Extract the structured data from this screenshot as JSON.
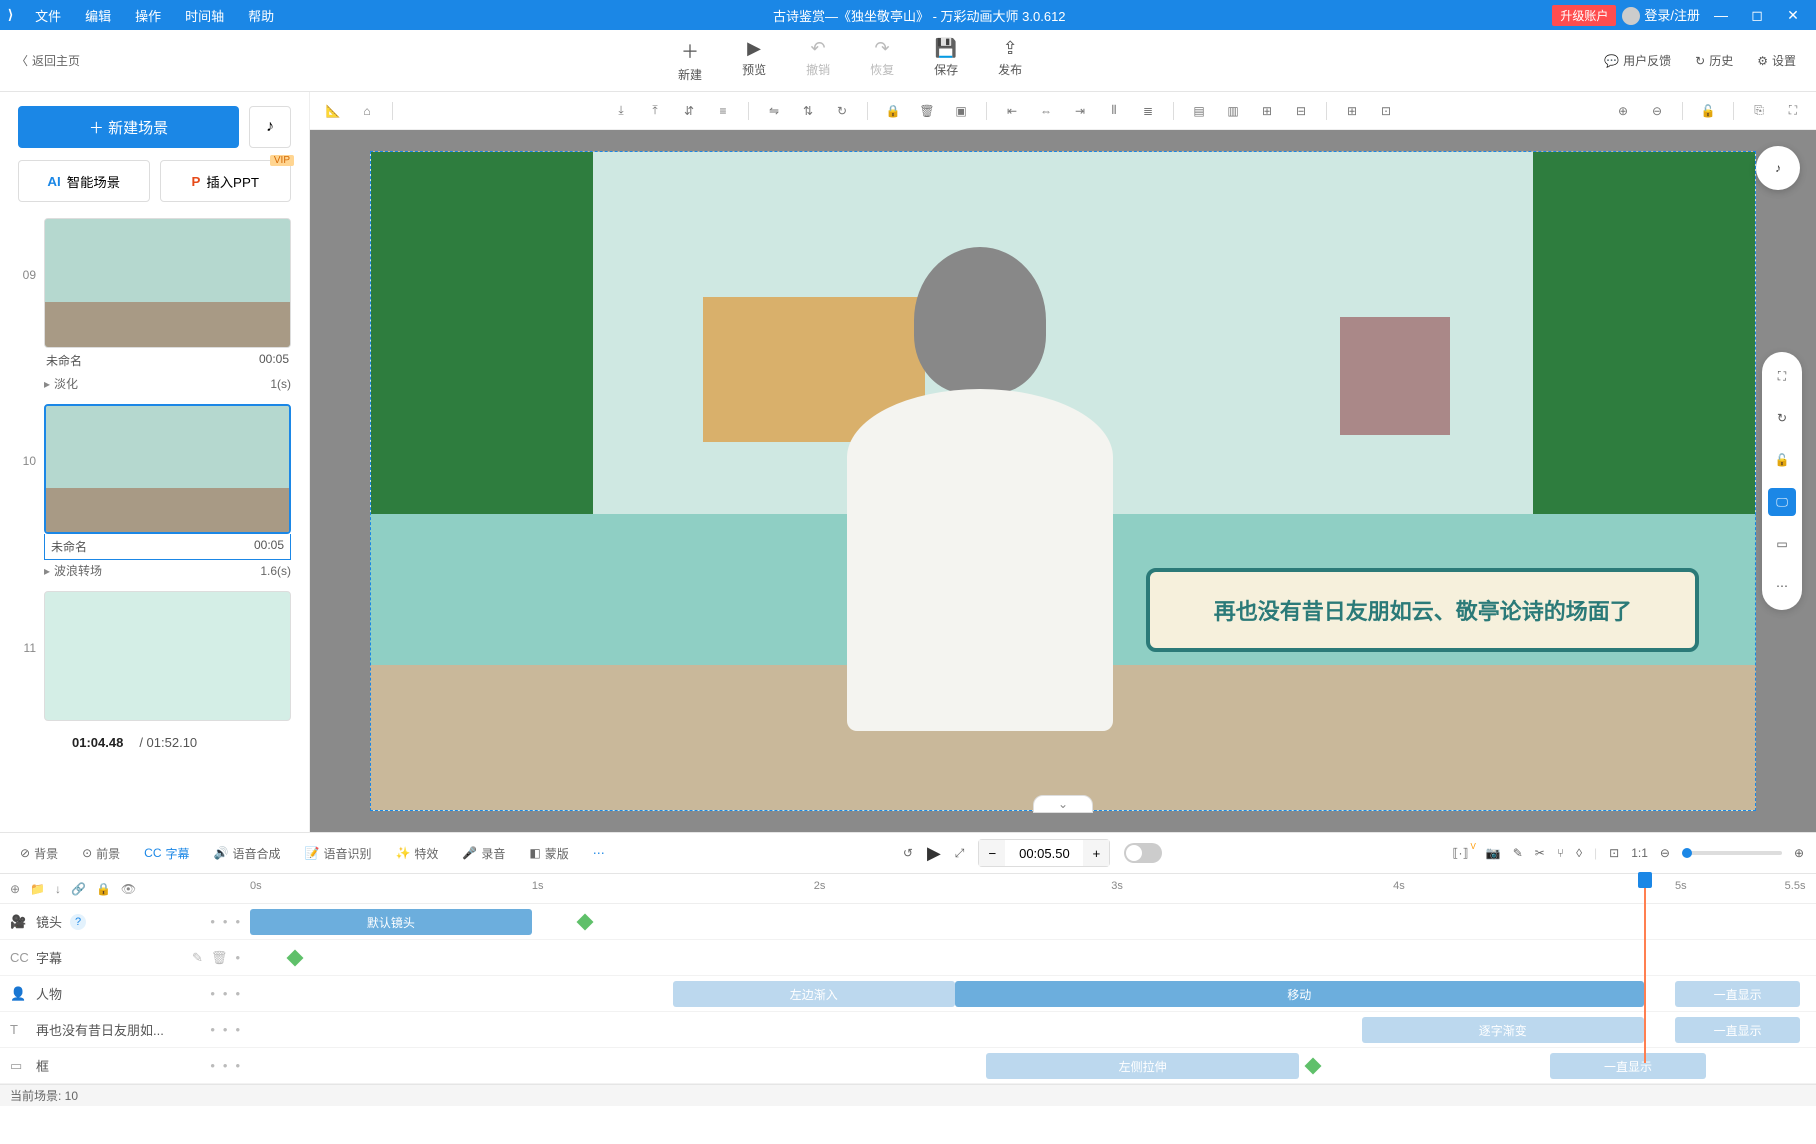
{
  "titlebar": {
    "menus": [
      "文件",
      "编辑",
      "操作",
      "时间轴",
      "帮助"
    ],
    "title": "古诗鉴赏—《独坐敬亭山》 - 万彩动画大师 3.0.612",
    "upgrade": "升级账户",
    "login": "登录/注册"
  },
  "toolbar": {
    "back": "返回主页",
    "items": [
      {
        "label": "新建",
        "icon": "＋"
      },
      {
        "label": "预览",
        "icon": "▶"
      },
      {
        "label": "撤销",
        "icon": "↶",
        "disabled": true
      },
      {
        "label": "恢复",
        "icon": "↷",
        "disabled": true
      },
      {
        "label": "保存",
        "icon": "💾"
      },
      {
        "label": "发布",
        "icon": "⇪"
      }
    ],
    "right": [
      {
        "label": "用户反馈",
        "icon": "💬"
      },
      {
        "label": "历史",
        "icon": "↻"
      },
      {
        "label": "设置",
        "icon": "⚙"
      }
    ]
  },
  "left": {
    "new_scene": "＋ 新建场景",
    "smart_scene": "智能场景",
    "insert_ppt": "插入PPT",
    "vip": "VIP",
    "scenes": [
      {
        "num": "09",
        "name": "未命名",
        "dur": "00:05",
        "trans": "淡化",
        "trans_t": "1(s)"
      },
      {
        "num": "10",
        "name": "未命名",
        "dur": "00:05",
        "trans": "波浪转场",
        "trans_t": "1.6(s)",
        "selected": true
      },
      {
        "num": "11",
        "name": "",
        "dur": ""
      }
    ],
    "time_current": "01:04.48",
    "time_total": "/ 01:52.10"
  },
  "stage": {
    "cam_label": "默认镜头",
    "speech": "再也没有昔日友朋如云、敬亭论诗的场面了"
  },
  "bottom_tabs": {
    "tabs": [
      "背景",
      "前景",
      "字幕",
      "语音合成",
      "语音识别",
      "特效",
      "录音",
      "蒙版"
    ],
    "active_index": 2,
    "time": "00:05.50"
  },
  "timeline": {
    "ticks": [
      "0s",
      "1s",
      "2s",
      "3s",
      "4s",
      "5s",
      "5.5s"
    ],
    "rows": [
      {
        "icon": "🎥",
        "label": "镜头",
        "help": true
      },
      {
        "icon": "CC",
        "label": "字幕"
      },
      {
        "icon": "👤",
        "label": "人物"
      },
      {
        "icon": "T",
        "label": "再也没有昔日友朋如..."
      },
      {
        "icon": "▭",
        "label": "框"
      }
    ],
    "clips": {
      "camera": {
        "label": "默认镜头"
      },
      "person_in": {
        "label": "左边渐入"
      },
      "person_move": {
        "label": "移动"
      },
      "person_hold": {
        "label": "一直显示"
      },
      "text_in": {
        "label": "逐字渐变"
      },
      "text_hold": {
        "label": "一直显示"
      },
      "frame_in": {
        "label": "左侧拉伸"
      },
      "frame_hold": {
        "label": "一直显示"
      }
    }
  },
  "status": {
    "current": "当前场景: 10"
  }
}
